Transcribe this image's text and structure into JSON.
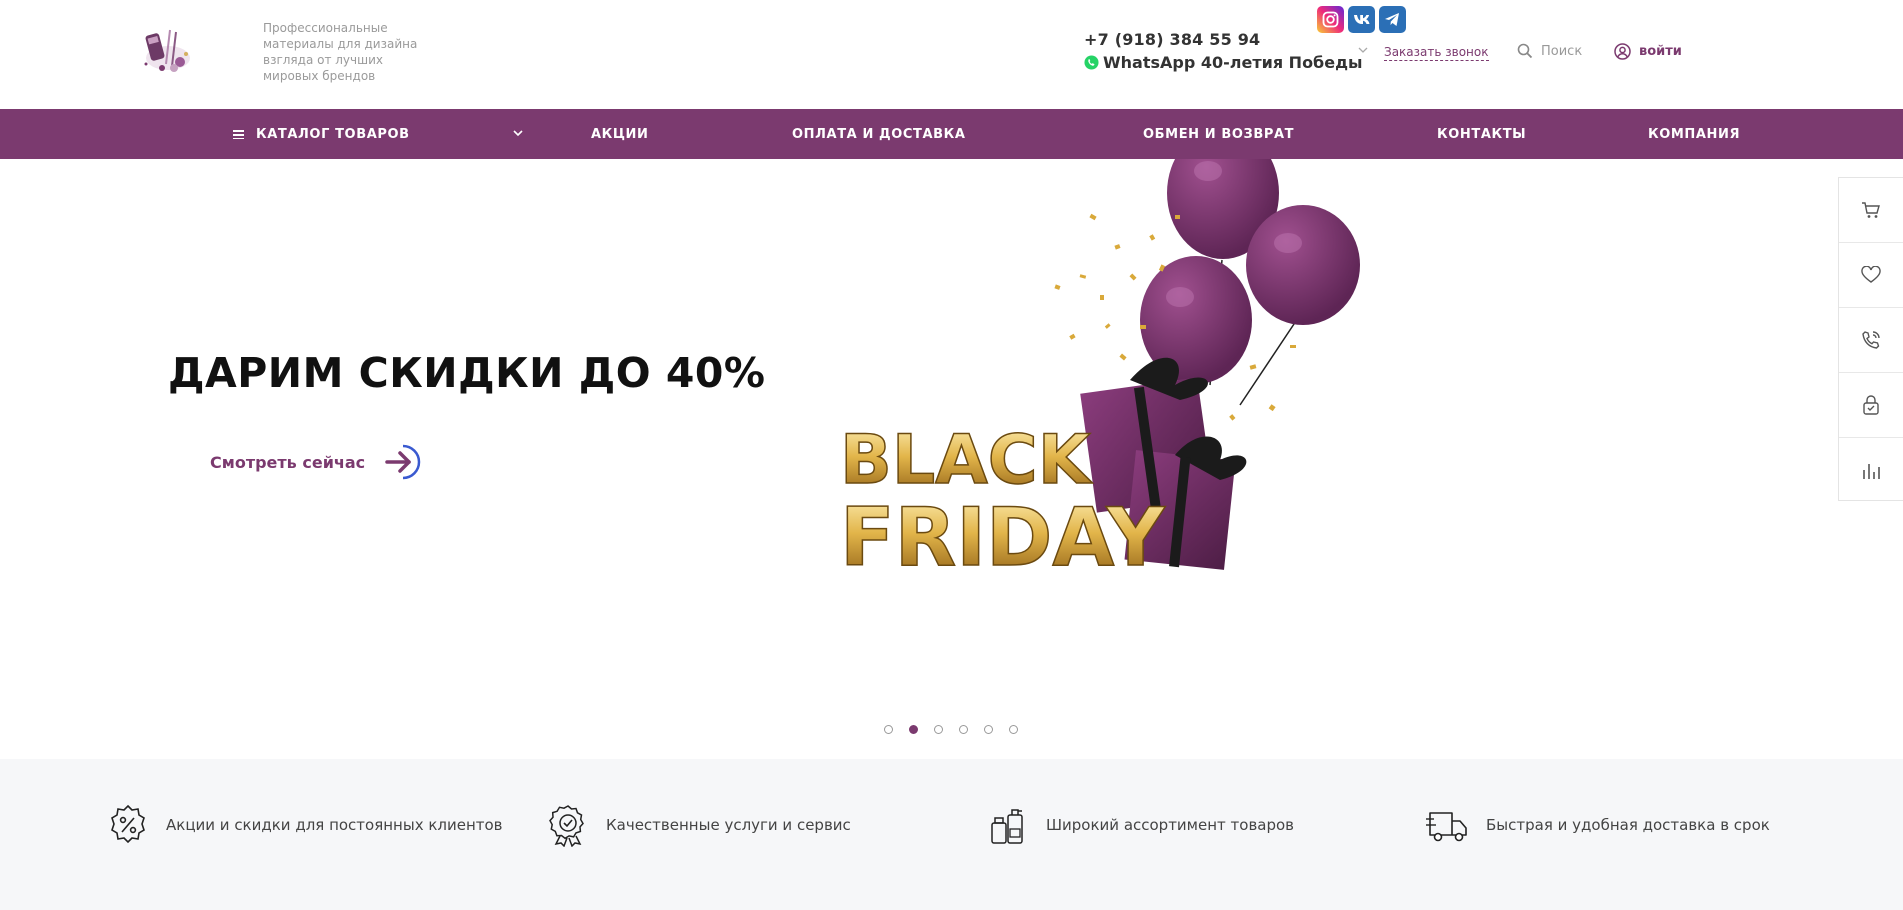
{
  "header": {
    "tagline": "Профессиональные материалы для дизайна взгляда от лучших мировых брендов",
    "phone": "+7 (918) 384 55 94",
    "whatsapp": "WhatsApp 40-летия Победы",
    "callback": "Заказать звонок",
    "search_label": "Поиск",
    "login_label": "войти",
    "socials": [
      "instagram-icon",
      "vk-icon",
      "telegram-icon"
    ]
  },
  "nav": {
    "catalog": "КАТАЛОГ ТОВАРОВ",
    "items": [
      "АКЦИИ",
      "ОПЛАТА И ДОСТАВКА",
      "ОБМЕН И ВОЗВРАТ",
      "КОНТАКТЫ",
      "КОМПАНИЯ"
    ]
  },
  "hero": {
    "title": "ДАРИМ СКИДКИ ДО 40%",
    "cta": "Смотреть сейчас",
    "banner_text_1": "BLACK",
    "banner_text_2": "FRIDAY",
    "slides_count": 6,
    "active_slide": 2
  },
  "side_panel": [
    "cart-icon",
    "heart-icon",
    "phone-callback-icon",
    "lock-bag-icon",
    "compare-icon"
  ],
  "features": [
    {
      "icon": "discount-badge-icon",
      "text": "Акции и скидки для постоянных клиентов"
    },
    {
      "icon": "quality-badge-icon",
      "text": "Качественные услуги и сервис"
    },
    {
      "icon": "products-icon",
      "text": "Широкий ассортимент товаров"
    },
    {
      "icon": "delivery-truck-icon",
      "text": "Быстрая и удобная доставка в срок"
    }
  ],
  "colors": {
    "brand": "#7b3a6f",
    "features_bg": "#f6f7f9",
    "whatsapp": "#25d366"
  }
}
